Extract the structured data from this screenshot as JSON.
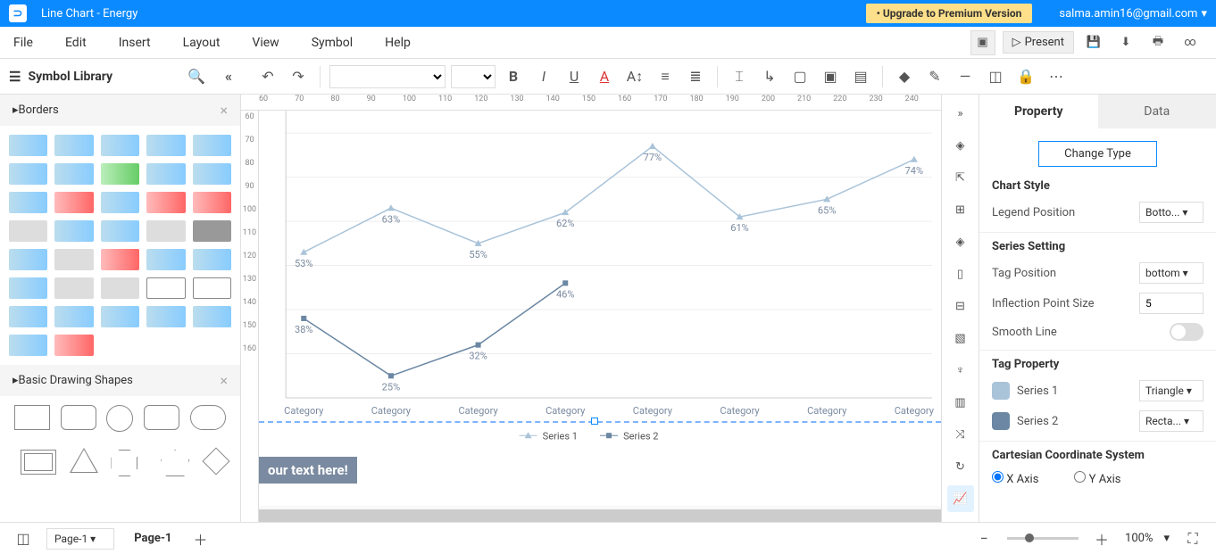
{
  "title": "Line Chart - Energy",
  "upgrade": "• Upgrade to Premium Version",
  "user": "salma.amin16@gmail.com",
  "menu": [
    "File",
    "Edit",
    "Insert",
    "Layout",
    "View",
    "Symbol",
    "Help"
  ],
  "present": "Present",
  "library": {
    "title": "Symbol Library",
    "cat1": "Borders",
    "cat2": "Basic Drawing Shapes"
  },
  "rulerH": [
    "60",
    "70",
    "80",
    "90",
    "100",
    "110",
    "120",
    "130",
    "140",
    "150",
    "160",
    "170",
    "180",
    "190",
    "200",
    "210",
    "220",
    "230",
    "240"
  ],
  "rulerV": [
    "60",
    "70",
    "80",
    "90",
    "100",
    "110",
    "120",
    "130",
    "140",
    "150",
    "160"
  ],
  "textBox": "our text here!",
  "page": {
    "selector": "Page-1",
    "tab": "Page-1"
  },
  "zoom": "100%",
  "rp": {
    "tabProperty": "Property",
    "tabData": "Data",
    "changeType": "Change Type",
    "chartStyle": "Chart Style",
    "legendPos": "Legend Position",
    "legendVal": "Botto...",
    "seriesSetting": "Series Setting",
    "tagPos": "Tag Position",
    "tagPosVal": "bottom",
    "inflection": "Inflection Point Size",
    "inflectionVal": "5",
    "smooth": "Smooth Line",
    "tagProperty": "Tag Property",
    "s1": "Series 1",
    "s1v": "Triangle",
    "s2": "Series 2",
    "s2v": "Recta...",
    "ccs": "Cartesian Coordinate System",
    "xaxis": "X Axis",
    "yaxis": "Y Axis"
  },
  "chart_data": {
    "type": "line",
    "categories": [
      "Category",
      "Category",
      "Category",
      "Category",
      "Category",
      "Category",
      "Category",
      "Category"
    ],
    "series": [
      {
        "name": "Series 1",
        "values": [
          53,
          63,
          55,
          62,
          77,
          61,
          65,
          74
        ],
        "marker": "triangle",
        "color": "#a9c3d9"
      },
      {
        "name": "Series 2",
        "values": [
          38,
          25,
          32,
          46,
          null,
          null,
          null,
          null
        ],
        "marker": "square",
        "color": "#6b87a3"
      }
    ],
    "xlabel": "",
    "ylabel": "",
    "legend_position": "bottom"
  }
}
